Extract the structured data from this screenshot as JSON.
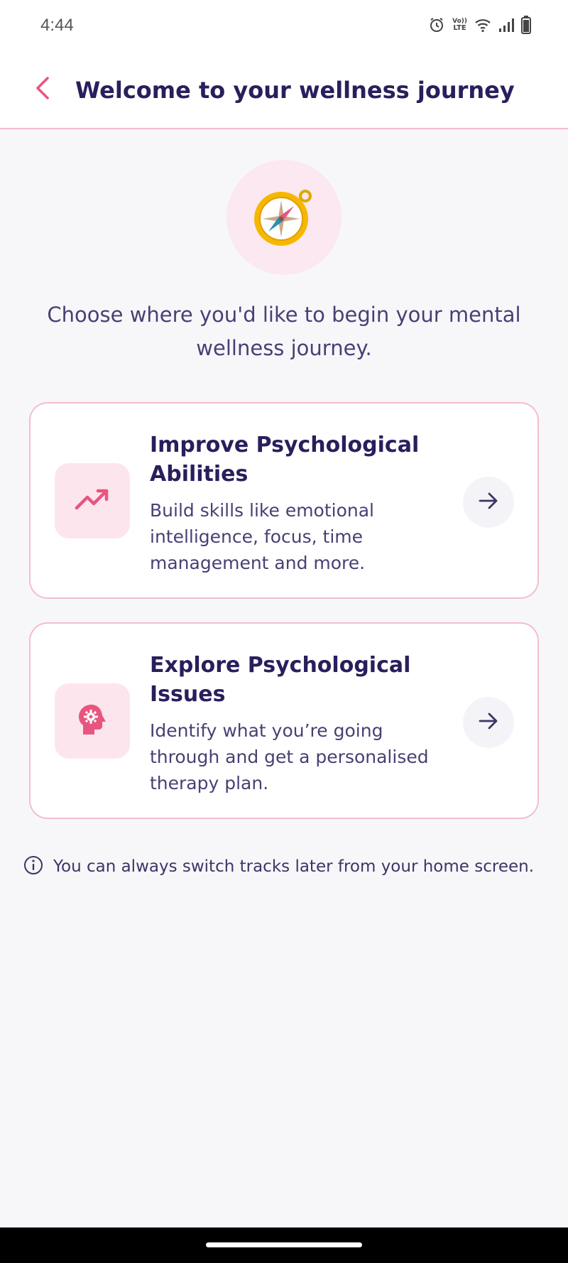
{
  "status_bar": {
    "time": "4:44",
    "icons": [
      "alarm-icon",
      "volte-icon",
      "wifi-icon",
      "signal-icon",
      "battery-icon"
    ],
    "volte_label": "LTE"
  },
  "header": {
    "back_icon": "chevron-left-icon",
    "title": "Welcome to your wellness journey"
  },
  "hero": {
    "icon": "compass-icon"
  },
  "intro_text": "Choose where you'd like to begin your mental wellness journey.",
  "tracks": [
    {
      "icon": "trending-up-icon",
      "title": "Improve Psychological Abilities",
      "description": "Build skills like emotional intelligence, focus, time management and more.",
      "action_icon": "arrow-right-icon"
    },
    {
      "icon": "head-gear-icon",
      "title": "Explore Psychological Issues",
      "description": "Identify what you’re going through and get a personalised therapy plan.",
      "action_icon": "arrow-right-icon"
    }
  ],
  "note": {
    "icon": "info-icon",
    "text": "You can always switch tracks later from your home screen."
  },
  "colors": {
    "accent": "#e8557f",
    "text_primary": "#2a1e5c",
    "card_border": "#f3bcd2",
    "icon_bg": "#fde5ee",
    "background": "#f7f7fa"
  }
}
